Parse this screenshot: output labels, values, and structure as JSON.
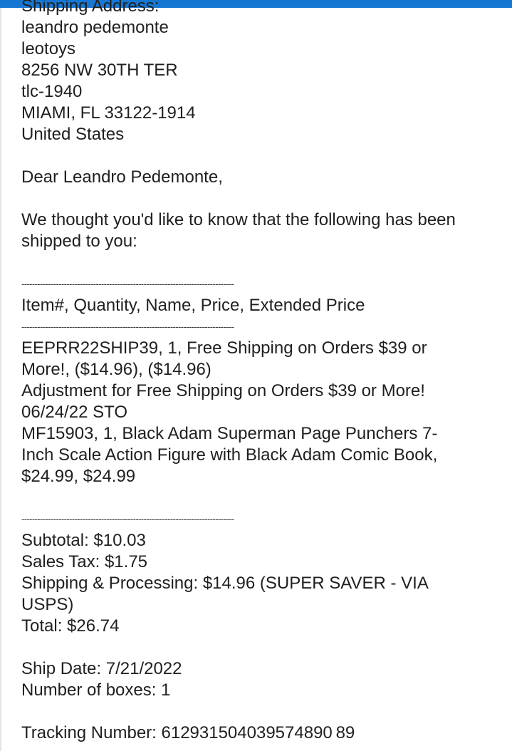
{
  "email": {
    "shipping_address_label": "Shipping Address:",
    "address": [
      "leandro pedemonte",
      "leotoys",
      "8256 NW 30TH TER",
      "tlc-1940",
      "MIAMI, FL 33122-1914",
      "United States"
    ],
    "greeting": "Dear Leandro Pedemonte,",
    "intro": [
      "We thought you'd like to know that the following has been",
      "shipped to you:"
    ],
    "divider": "--------------------------------------------------------------------------------",
    "header_row": "Item#,  Quantity,  Name,  Price,  Extended Price",
    "items": [
      "EEPRR22SHIP39,  1,  Free Shipping on Orders $39 or",
      "More!,  ($14.96),  ($14.96)",
      "Adjustment for Free Shipping on Orders $39 or More!",
      "06/24/22 STO",
      "MF15903,  1,  Black Adam Superman Page Punchers 7-",
      "Inch Scale Action Figure with Black Adam Comic Book,",
      "$24.99,  $24.99"
    ],
    "totals": [
      "Subtotal: $10.03",
      "Sales Tax:  $1.75",
      "Shipping & Processing: $14.96 (SUPER SAVER - VIA",
      "USPS)",
      "Total: $26.74"
    ],
    "ship_date": "Ship Date: 7/21/2022",
    "boxes": "Number of boxes: 1",
    "tracking": "Tracking Number: 612931504039574890 89"
  },
  "colors": {
    "topbar": "#1677d2",
    "link": "#1a0dab"
  }
}
